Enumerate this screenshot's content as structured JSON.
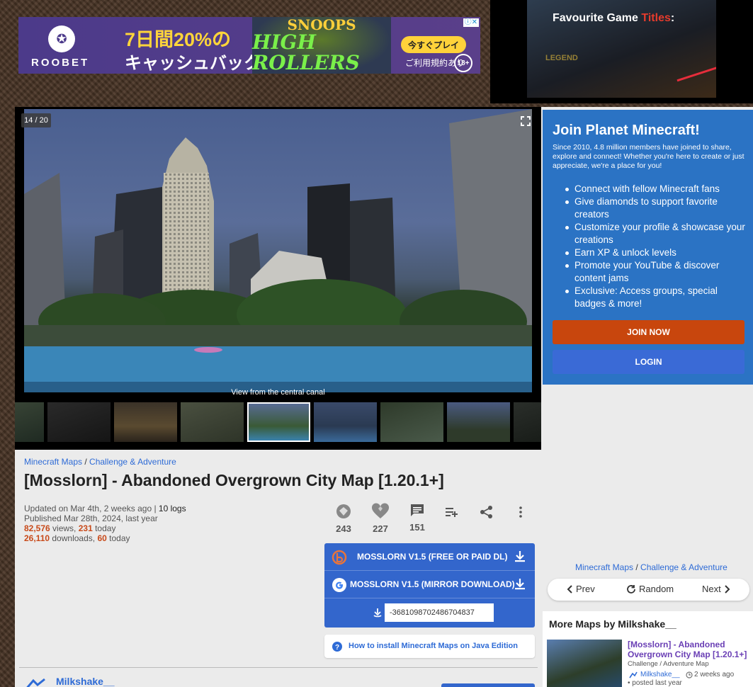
{
  "top_ad": {
    "brand": "ROOBET",
    "headline": "7日間20%の",
    "subline": "キャッシュバック",
    "game_line1": "SNOOPS",
    "game_line2": "HIGH ROLLERS",
    "cta": "今すぐプレイ",
    "terms": "ご利用規約あり",
    "age": "18+"
  },
  "video_ad": {
    "title_prefix": "Favourite Game ",
    "title_highlight": "Titles",
    "title_suffix": ":",
    "overlay": "LEGEND"
  },
  "gallery": {
    "counter": "14 / 20",
    "caption": "View from the central canal",
    "active_thumb": 4
  },
  "breadcrumb": {
    "cat1": "Minecraft Maps",
    "sep": " / ",
    "cat2": "Challenge & Adventure"
  },
  "title": "[Mosslorn] - Abandoned Overgrown City Map [1.20.1+]",
  "meta": {
    "updated": "Updated on Mar 4th, 2 weeks ago | ",
    "logs": "10 logs",
    "published": "Published Mar 28th, 2024, last year",
    "views": "82,576",
    "views_label": " views, ",
    "views_today": "231",
    "today_label": " today",
    "downloads": "26,110",
    "downloads_label": " downloads, ",
    "downloads_today": "60"
  },
  "stats": {
    "diamonds": "243",
    "hearts": "227",
    "comments": "151"
  },
  "downloads": {
    "primary": "MOSSLORN V1.5 (FREE OR PAID DL)",
    "mirror": "MOSSLORN V1.5 (MIRROR DOWNLOAD)",
    "seed": "-3681098702486704837"
  },
  "howto": "How to install Minecraft Maps on Java Edition",
  "author": "Milkshake__",
  "join": {
    "title": "Join Planet Minecraft!",
    "desc": "Since 2010, 4.8 million members have joined to share, explore and connect! Whether you're here to create or just appreciate, we're a place for you!",
    "benefits": [
      "Connect with fellow Minecraft fans",
      "Give diamonds to support favorite creators",
      "Customize your profile & showcase your creations",
      "Earn XP & unlock levels",
      "Promote your YouTube & discover content jams",
      "Exclusive: Access groups, special badges & more!"
    ],
    "join_btn": "JOIN NOW",
    "login_btn": "LOGIN"
  },
  "nav": {
    "prev": "Prev",
    "random": "Random",
    "next": "Next"
  },
  "more_maps": {
    "title": "More Maps by Milkshake__",
    "item_title": "[Mosslorn] - Abandoned Overgrown City Map [1.20.1+]",
    "item_category": "Challenge / Adventure Map",
    "item_author": "Milkshake__",
    "item_time": "2 weeks ago",
    "item_posted": "• posted  last year"
  },
  "colors": {
    "accent": "#3366cc",
    "join_bg": "#2b73c4",
    "join_btn": "#c8460d",
    "link": "#2e6bd6",
    "stat_num": "#c84a1a"
  }
}
